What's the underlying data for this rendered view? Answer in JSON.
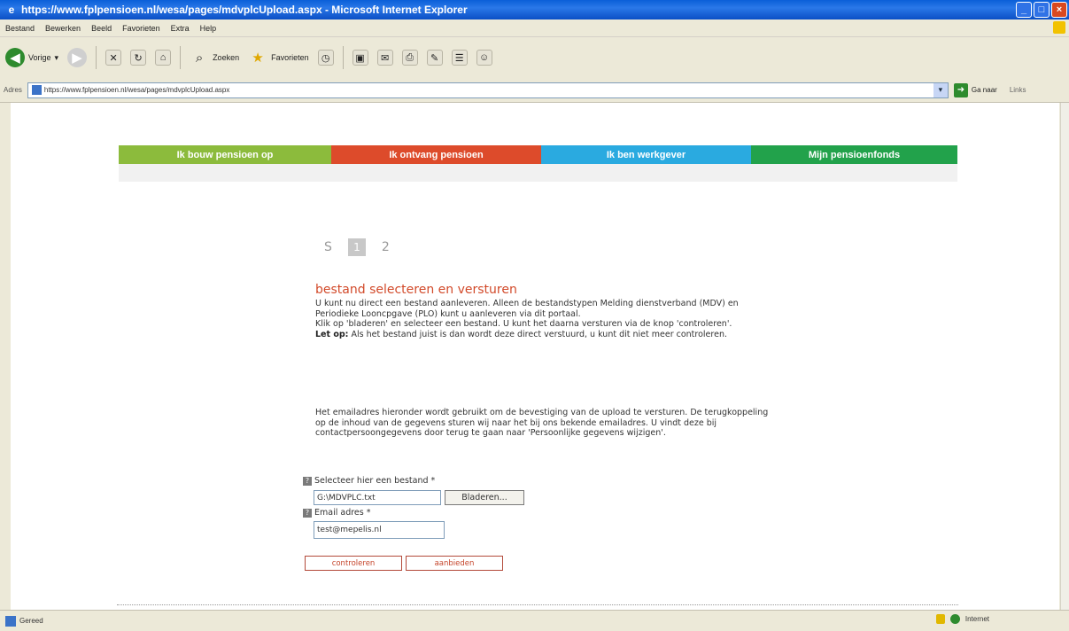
{
  "window": {
    "title": "https://www.fplpensioen.nl/wesa/pages/mdvplcUpload.aspx - Microsoft Internet Explorer"
  },
  "menu": [
    "Bestand",
    "Bewerken",
    "Beeld",
    "Favorieten",
    "Extra",
    "Help"
  ],
  "toolbar": {
    "back_label": "Vorige",
    "search_label": "Zoeken",
    "favorites_label": "Favorieten"
  },
  "address": {
    "label": "Adres",
    "url": "https://www.fplpensioen.nl/wesa/pages/mdvplcUpload.aspx",
    "go_label": "Ga naar",
    "links_label": "Links"
  },
  "nav": {
    "tabs": [
      {
        "label": "Ik bouw pensioen op",
        "color": "#8cbb3c",
        "width": 240
      },
      {
        "label": "Ik ontvang pensioen",
        "color": "#dd4b2b",
        "width": 237
      },
      {
        "label": "Ik ben werkgever",
        "color": "#2aaae0",
        "width": 237
      },
      {
        "label": "Mijn pensioenfonds",
        "color": "#22a24b",
        "width": 233
      }
    ]
  },
  "steps": {
    "s": "S",
    "current": "1",
    "next": "2"
  },
  "form": {
    "heading": "bestand selecteren en versturen",
    "p1_intro": "U kunt nu direct een bestand aanleveren. Alleen de bestandstypen Melding dienstverband (MDV) en Periodieke Looncpgave (PLO) kunt u aanleveren via dit portaal.",
    "p1_click": "Klik op 'bladeren' en selecteer een bestand. U kunt het daarna versturen via de knop 'controleren'.",
    "p1_note_label": "Let op:",
    "p1_note_text": " Als het bestand juist is dan wordt deze direct verstuurd, u kunt dit niet meer controleren.",
    "p2": "Het emailadres hieronder wordt gebruikt om de bevestiging van de upload te versturen. De terugkoppeling op de inhoud van de gegevens sturen wij naar het bij ons bekende emailadres. U vindt deze bij contactpersoongegevens door terug te gaan naar 'Persoonlijke gegevens wijzigen'.",
    "file_label": "Selecteer hier een bestand *",
    "file_value": "G:\\MDVPLC.txt",
    "browse_label": "Bladeren...",
    "email_label": "Email adres *",
    "email_value": "test@mepelis.nl",
    "check_label": "controleren",
    "send_label": "aanbieden"
  },
  "status": {
    "left": "Gereed",
    "zone": "Internet"
  }
}
